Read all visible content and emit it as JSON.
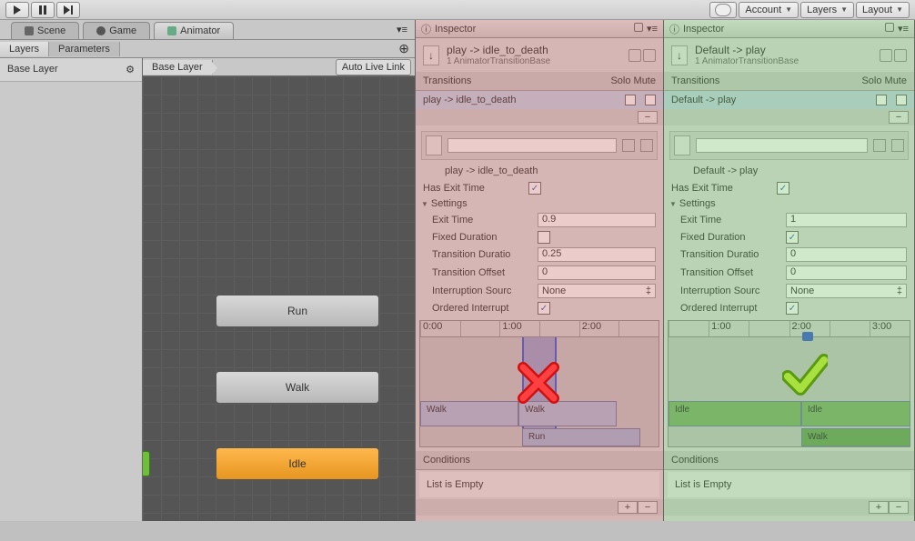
{
  "toolbar": {
    "account": "Account",
    "layers": "Layers",
    "layout": "Layout"
  },
  "tabs": {
    "scene": "Scene",
    "game": "Game",
    "animator": "Animator",
    "inspector": "Inspector"
  },
  "animator": {
    "subtabs": {
      "layers": "Layers",
      "parameters": "Parameters"
    },
    "layer_name": "Base Layer",
    "crumb": "Base Layer",
    "autolive": "Auto Live Link",
    "nodes": {
      "run": "Run",
      "walk": "Walk",
      "idle": "Idle"
    }
  },
  "inspector_red": {
    "title": "play -> idle_to_death",
    "subtitle": "1 AnimatorTransitionBase",
    "sec_transitions": "Transitions",
    "sec_solo": "Solo",
    "sec_mute": "Mute",
    "row_name": "play -> idle_to_death",
    "mid_name": "play -> idle_to_death",
    "fields": {
      "has_exit_time": "Has Exit Time",
      "settings": "Settings",
      "exit_time_lbl": "Exit Time",
      "exit_time_val": "0.9",
      "fixed_duration": "Fixed Duration",
      "trans_dur_lbl": "Transition Duratio",
      "trans_dur_val": "0.25",
      "trans_off_lbl": "Transition Offset",
      "trans_off_val": "0",
      "intr_src_lbl": "Interruption Sourc",
      "intr_src_val": "None",
      "ordered": "Ordered Interrupt"
    },
    "ruler": [
      "0:00",
      "",
      "1:00",
      "",
      "2:00",
      ""
    ],
    "clips": {
      "walk1": "Walk",
      "walk2": "Walk",
      "run": "Run"
    },
    "conditions": "Conditions",
    "empty": "List is Empty"
  },
  "inspector_green": {
    "title": "Default -> play",
    "subtitle": "1 AnimatorTransitionBase",
    "sec_transitions": "Transitions",
    "sec_solo": "Solo",
    "sec_mute": "Mute",
    "row_name": "Default -> play",
    "mid_name": "Default -> play",
    "fields": {
      "has_exit_time": "Has Exit Time",
      "settings": "Settings",
      "exit_time_lbl": "Exit Time",
      "exit_time_val": "1",
      "fixed_duration": "Fixed Duration",
      "trans_dur_lbl": "Transition Duratio",
      "trans_dur_val": "0",
      "trans_off_lbl": "Transition Offset",
      "trans_off_val": "0",
      "intr_src_lbl": "Interruption Sourc",
      "intr_src_val": "None",
      "ordered": "Ordered Interrupt"
    },
    "ruler": [
      "",
      "1:00",
      "",
      "2:00",
      "",
      "3:00"
    ],
    "clips": {
      "idle1": "Idle",
      "idle2": "Idle",
      "walk": "Walk"
    },
    "conditions": "Conditions",
    "empty": "List is Empty"
  }
}
